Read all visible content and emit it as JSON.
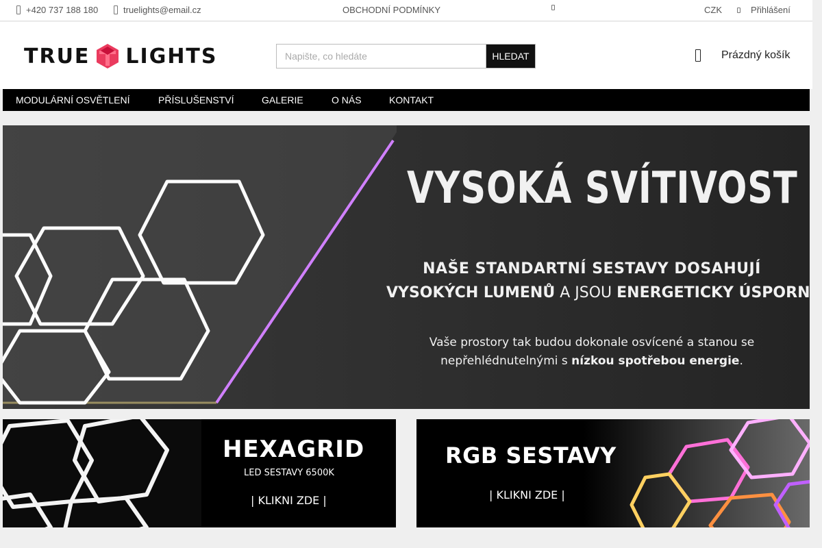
{
  "topbar": {
    "phone": "+420 737 188 180",
    "email": "truelights@email.cz",
    "terms": "OBCHODNÍ PODMÍNKY",
    "currency": "CZK",
    "login": "Přihlášení"
  },
  "header": {
    "logo_left": "TRUE",
    "logo_right": "LIGHTS",
    "search_placeholder": "Napište, co hledáte",
    "search_button": "HLEDAT",
    "cart_label": "Prázdný košík"
  },
  "nav": {
    "items": [
      "MODULÁRNÍ OSVĚTLENÍ",
      "PŘÍSLUŠENSTVÍ",
      "GALERIE",
      "O NÁS",
      "KONTAKT"
    ]
  },
  "hero": {
    "title": "VYSOKÁ SVÍTIVOST",
    "line1": "NAŠE STANDARTNÍ SESTAVY DOSAHUJÍ",
    "line2_a": "VYSOKÝCH LUMENŮ",
    "line2_b": " A JSOU ",
    "line2_c": "ENERGETICKY ÚSPORNÉ",
    "line3": "Vaše prostory tak budou dokonale osvícené a stanou se",
    "line4_a": "nepřehlédnutelnými s ",
    "line4_b": "nízkou spotřebou energie",
    "line4_c": "."
  },
  "promos": {
    "hexagrid": {
      "title": "HEXAGRID",
      "subtitle": "LED SESTAVY 6500K",
      "cta": "| KLIKNI ZDE |"
    },
    "rgb": {
      "title": "RGB SESTAVY",
      "cta": "| KLIKNI ZDE |"
    }
  },
  "icons": {
    "phone": "phone-icon",
    "email": "email-icon",
    "theme": "theme-icon",
    "currency_dropdown": "chevron-down-icon",
    "cart": "cart-icon"
  },
  "colors": {
    "brand_red": "#e8264c",
    "black": "#000000",
    "white": "#ffffff"
  }
}
